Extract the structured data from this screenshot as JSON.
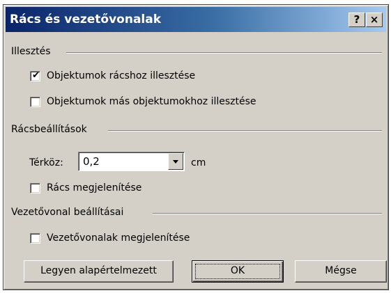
{
  "dialog": {
    "title": "Rács és vezetővonalak",
    "help_button": "?",
    "close_button": "×"
  },
  "snap_group": {
    "label": "Illesztés",
    "snap_to_grid": {
      "label_pre": "Objektumok rácshoz illesztése",
      "checked": true
    },
    "snap_to_objects": {
      "label": "Objektumok más objektumokhoz illesztése",
      "checked": false
    }
  },
  "grid_group": {
    "label": "Rácsbeállítások",
    "spacing_label": "Térköz:",
    "spacing_value": "0,2",
    "spacing_unit": "cm",
    "show_grid": {
      "label": "Rács megjelenítése",
      "checked": false
    }
  },
  "guides_group": {
    "label": "Vezetővonal beállításai",
    "show_guides": {
      "label": "Vezetővonalak megjelenítése",
      "checked": false
    }
  },
  "buttons": {
    "set_default": "Legyen alapértelmezett",
    "ok": "OK",
    "cancel": "Mégse"
  }
}
